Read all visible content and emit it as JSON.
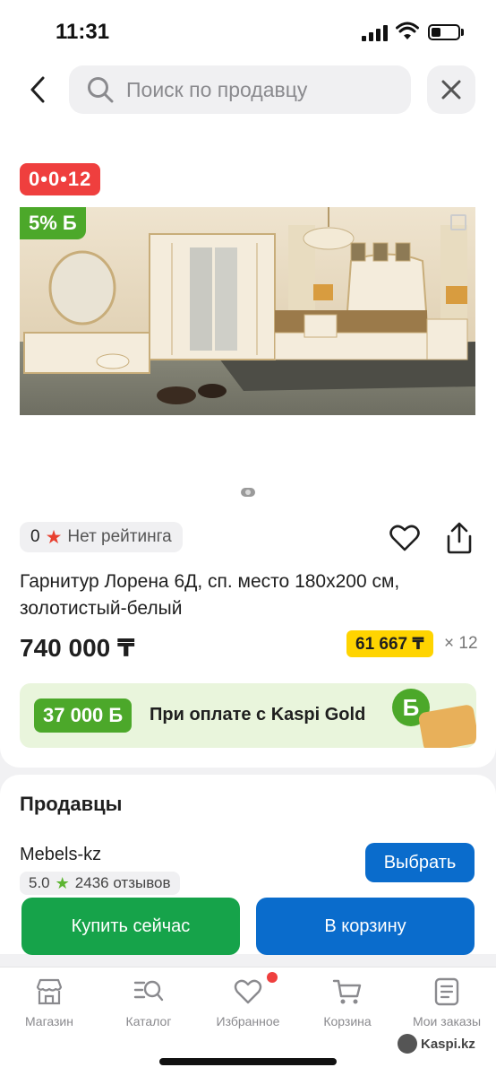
{
  "status_bar": {
    "time": "11:31"
  },
  "search": {
    "placeholder": "Поиск по продавцу"
  },
  "product": {
    "installment_badge": "0•0•12",
    "discount_badge": "5% Б",
    "rating_count": "0",
    "rating_text": "Нет рейтинга",
    "title": "Гарнитур Лорена 6Д, сп. место 180x200 см, золотистый-белый",
    "price": "740 000 ₸",
    "monthly_payment": "61 667 ₸",
    "monthly_multiplier": "× 12"
  },
  "kaspi_gold": {
    "bonus_amount": "37 000 Б",
    "text": "При оплате с Kaspi Gold",
    "coin_symbol": "Б"
  },
  "sellers": {
    "title": "Продавцы",
    "items": [
      {
        "name": "Mebels-kz",
        "rating": "5.0",
        "reviews": "2436 отзывов",
        "choose_label": "Выбрать"
      }
    ]
  },
  "actions": {
    "buy_now": "Купить сейчас",
    "add_to_cart": "В корзину"
  },
  "bottom_nav": {
    "items": [
      {
        "label": "Магазин",
        "icon": "store-icon"
      },
      {
        "label": "Каталог",
        "icon": "catalog-icon"
      },
      {
        "label": "Избранное",
        "icon": "heart-icon"
      },
      {
        "label": "Корзина",
        "icon": "cart-icon"
      },
      {
        "label": "Мои заказы",
        "icon": "orders-icon"
      }
    ]
  },
  "watermark": "Kaspi.kz",
  "colors": {
    "accent_blue": "#0a6ccc",
    "buy_green": "#16a34a",
    "installment_red": "#ef3f3e",
    "monthly_yellow": "#ffd400",
    "bonus_green": "#4ca82a"
  }
}
